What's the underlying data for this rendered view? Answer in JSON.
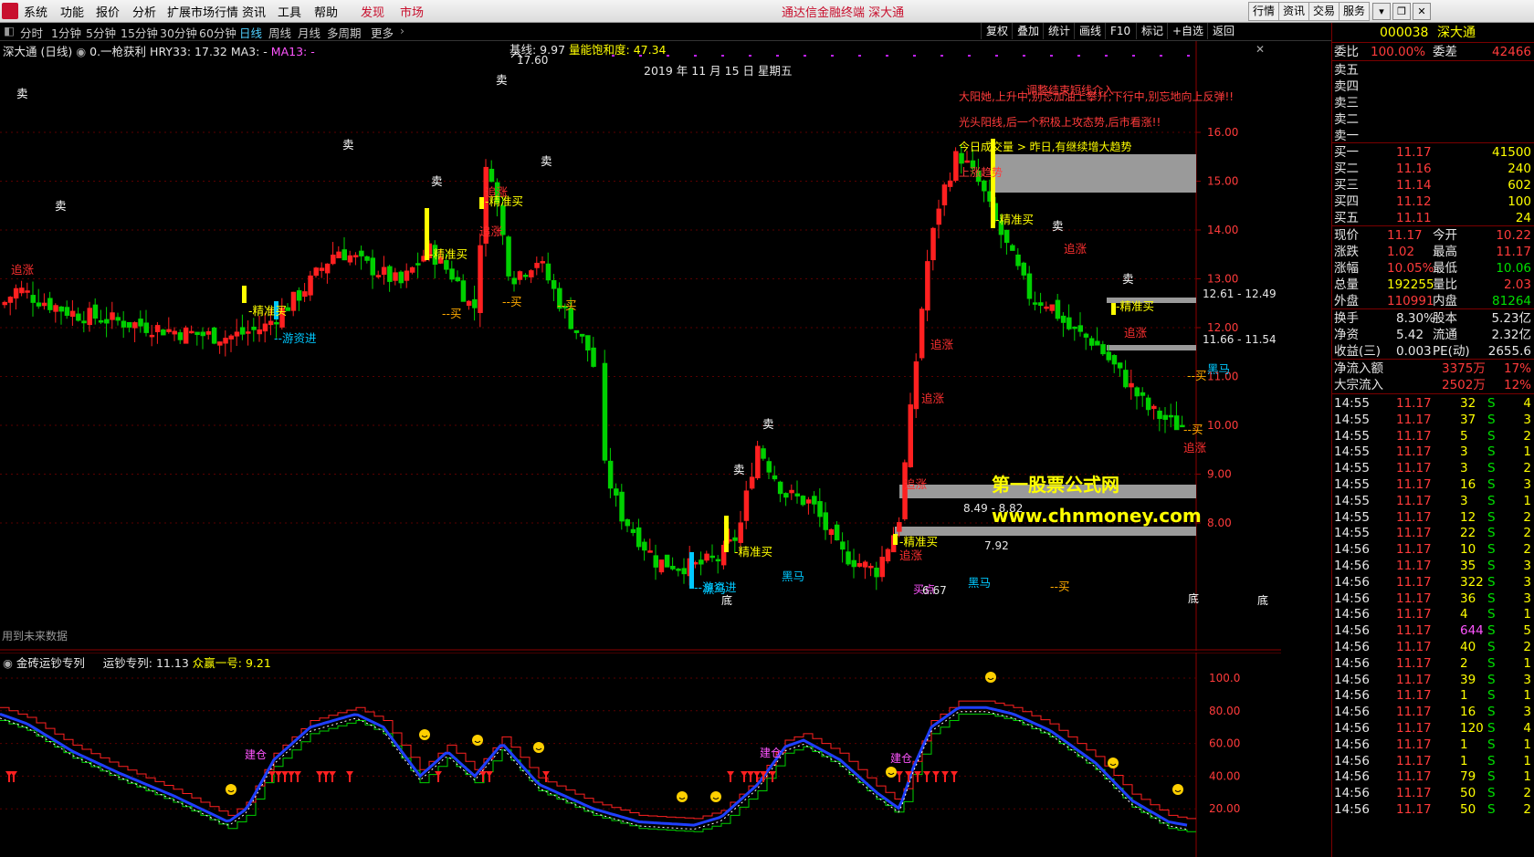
{
  "menubar": {
    "items": [
      "系统",
      "功能",
      "报价",
      "分析",
      "扩展市场行情",
      "资讯",
      "工具",
      "帮助"
    ],
    "discover": "发现",
    "market": "市场",
    "title": "通达信金融终端  深大通",
    "right_buttons": [
      "行情",
      "资讯",
      "交易",
      "服务"
    ]
  },
  "toolbar": {
    "periods": [
      "分时",
      "1分钟",
      "5分钟",
      "15分钟",
      "30分钟",
      "60分钟",
      "日线",
      "周线",
      "月线",
      "多周期",
      "更多"
    ],
    "active": "日线",
    "right_buttons": [
      "复权",
      "叠加",
      "统计",
      "画线",
      "F10",
      "标记",
      "+自选",
      "返回"
    ]
  },
  "main_chart": {
    "stock_title": "深大通 (日线)",
    "indicator_name": "0.一枪获利",
    "hry": "HRY33: 17.32",
    "ma3": "MA3: -",
    "ma13": "MA13: -",
    "baseline": "基线: 9.97",
    "energy": "量能饱和度: 47.34",
    "date": "2019 年 11 月 15 日 星期五",
    "high_mark": "17.60",
    "future_note": "用到未来数据",
    "y_ticks": [
      "16.00",
      "15.00",
      "14.00",
      "13.00",
      "12.00",
      "11.00",
      "10.00",
      "9.00",
      "8.00"
    ],
    "watermark1": "第一股票公式网",
    "watermark2": "www.chnmoney.com",
    "annotations_red": [
      "大阳她,上升中,别忘加油上攀升;下行中,别忘地向上反弹!!",
      "光头阳线,后一个积极上攻态势,后市看涨!!",
      "上涨趋势"
    ],
    "annotation_yellow": "今日成交量 > 昨日,有继续增大趋势",
    "annotation_yellow2": "调整结束短线介入",
    "range_labels": [
      "12.61 - 12.49",
      "11.66 - 11.54",
      "8.49 - 8.82",
      "7.92",
      "6.67"
    ],
    "labels": {
      "sell": "卖",
      "chase": "追涨",
      "precise_buy": "精准买",
      "buy": "--买",
      "hot_money": "--游资进",
      "dark_horse": "黑马",
      "bottom": "底",
      "buy_point": "买点"
    }
  },
  "sub_chart": {
    "title": "金砖运钞专列",
    "value1": "运钞专列: 11.13",
    "value2": "众赢一号: 9.21",
    "y_ticks": [
      "100.0",
      "80.00",
      "60.00",
      "40.00",
      "20.00"
    ],
    "build_label": "建仓"
  },
  "quote": {
    "code": "000038",
    "name": "深大通",
    "weibi_label": "委比",
    "weibi": "100.00%",
    "weicha_label": "委差",
    "weicha": "42466",
    "sell": [
      {
        "label": "卖五",
        "price": "",
        "vol": ""
      },
      {
        "label": "卖四",
        "price": "",
        "vol": ""
      },
      {
        "label": "卖三",
        "price": "",
        "vol": ""
      },
      {
        "label": "卖二",
        "price": "",
        "vol": ""
      },
      {
        "label": "卖一",
        "price": "",
        "vol": ""
      }
    ],
    "buy": [
      {
        "label": "买一",
        "price": "11.17",
        "vol": "41500"
      },
      {
        "label": "买二",
        "price": "11.16",
        "vol": "240"
      },
      {
        "label": "买三",
        "price": "11.14",
        "vol": "602"
      },
      {
        "label": "买四",
        "price": "11.12",
        "vol": "100"
      },
      {
        "label": "买五",
        "price": "11.11",
        "vol": "24"
      }
    ],
    "stats": [
      {
        "l1": "现价",
        "v1": "11.17",
        "c1": "red",
        "l2": "今开",
        "v2": "10.22",
        "c2": "red"
      },
      {
        "l1": "涨跌",
        "v1": "1.02",
        "c1": "red",
        "l2": "最高",
        "v2": "11.17",
        "c2": "red"
      },
      {
        "l1": "涨幅",
        "v1": "10.05%",
        "c1": "red",
        "l2": "最低",
        "v2": "10.06",
        "c2": "green"
      },
      {
        "l1": "总量",
        "v1": "192255",
        "c1": "yellow",
        "l2": "量比",
        "v2": "2.03",
        "c2": "red"
      },
      {
        "l1": "外盘",
        "v1": "110991",
        "c1": "red",
        "l2": "内盘",
        "v2": "81264",
        "c2": "green"
      }
    ],
    "stats2": [
      {
        "l1": "换手",
        "v1": "8.30%",
        "c1": "white",
        "l2": "股本",
        "v2": "5.23亿",
        "c2": "white"
      },
      {
        "l1": "净资",
        "v1": "5.42",
        "c1": "white",
        "l2": "流通",
        "v2": "2.32亿",
        "c2": "white"
      },
      {
        "l1": "收益(三)",
        "v1": "0.003",
        "c1": "white",
        "l2": "PE(动)",
        "v2": "2655.6",
        "c2": "white"
      }
    ],
    "flows": [
      {
        "label": "净流入额",
        "value": "3375万",
        "pct": "17%"
      },
      {
        "label": "大宗流入",
        "value": "2502万",
        "pct": "12%"
      }
    ],
    "ticks": [
      {
        "t": "14:55",
        "p": "11.17",
        "v": "32",
        "s": "S",
        "n": "4"
      },
      {
        "t": "14:55",
        "p": "11.17",
        "v": "37",
        "s": "S",
        "n": "3"
      },
      {
        "t": "14:55",
        "p": "11.17",
        "v": "5",
        "s": "S",
        "n": "2"
      },
      {
        "t": "14:55",
        "p": "11.17",
        "v": "3",
        "s": "S",
        "n": "1"
      },
      {
        "t": "14:55",
        "p": "11.17",
        "v": "3",
        "s": "S",
        "n": "2"
      },
      {
        "t": "14:55",
        "p": "11.17",
        "v": "16",
        "s": "S",
        "n": "3"
      },
      {
        "t": "14:55",
        "p": "11.17",
        "v": "3",
        "s": "S",
        "n": "1"
      },
      {
        "t": "14:55",
        "p": "11.17",
        "v": "12",
        "s": "S",
        "n": "2"
      },
      {
        "t": "14:55",
        "p": "11.17",
        "v": "22",
        "s": "S",
        "n": "2"
      },
      {
        "t": "14:56",
        "p": "11.17",
        "v": "10",
        "s": "S",
        "n": "2"
      },
      {
        "t": "14:56",
        "p": "11.17",
        "v": "35",
        "s": "S",
        "n": "3"
      },
      {
        "t": "14:56",
        "p": "11.17",
        "v": "322",
        "s": "S",
        "n": "3"
      },
      {
        "t": "14:56",
        "p": "11.17",
        "v": "36",
        "s": "S",
        "n": "3"
      },
      {
        "t": "14:56",
        "p": "11.17",
        "v": "4",
        "s": "S",
        "n": "1"
      },
      {
        "t": "14:56",
        "p": "11.17",
        "v": "644",
        "s": "S",
        "n": "5"
      },
      {
        "t": "14:56",
        "p": "11.17",
        "v": "40",
        "s": "S",
        "n": "2"
      },
      {
        "t": "14:56",
        "p": "11.17",
        "v": "2",
        "s": "S",
        "n": "1"
      },
      {
        "t": "14:56",
        "p": "11.17",
        "v": "39",
        "s": "S",
        "n": "3"
      },
      {
        "t": "14:56",
        "p": "11.17",
        "v": "1",
        "s": "S",
        "n": "1"
      },
      {
        "t": "14:56",
        "p": "11.17",
        "v": "16",
        "s": "S",
        "n": "3"
      },
      {
        "t": "14:56",
        "p": "11.17",
        "v": "120",
        "s": "S",
        "n": "4"
      },
      {
        "t": "14:56",
        "p": "11.17",
        "v": "1",
        "s": "S",
        "n": "1"
      },
      {
        "t": "14:56",
        "p": "11.17",
        "v": "1",
        "s": "S",
        "n": "1"
      },
      {
        "t": "14:56",
        "p": "11.17",
        "v": "79",
        "s": "S",
        "n": "1"
      },
      {
        "t": "14:56",
        "p": "11.17",
        "v": "50",
        "s": "S",
        "n": "2"
      },
      {
        "t": "14:56",
        "p": "11.17",
        "v": "50",
        "s": "S",
        "n": "2"
      }
    ]
  }
}
